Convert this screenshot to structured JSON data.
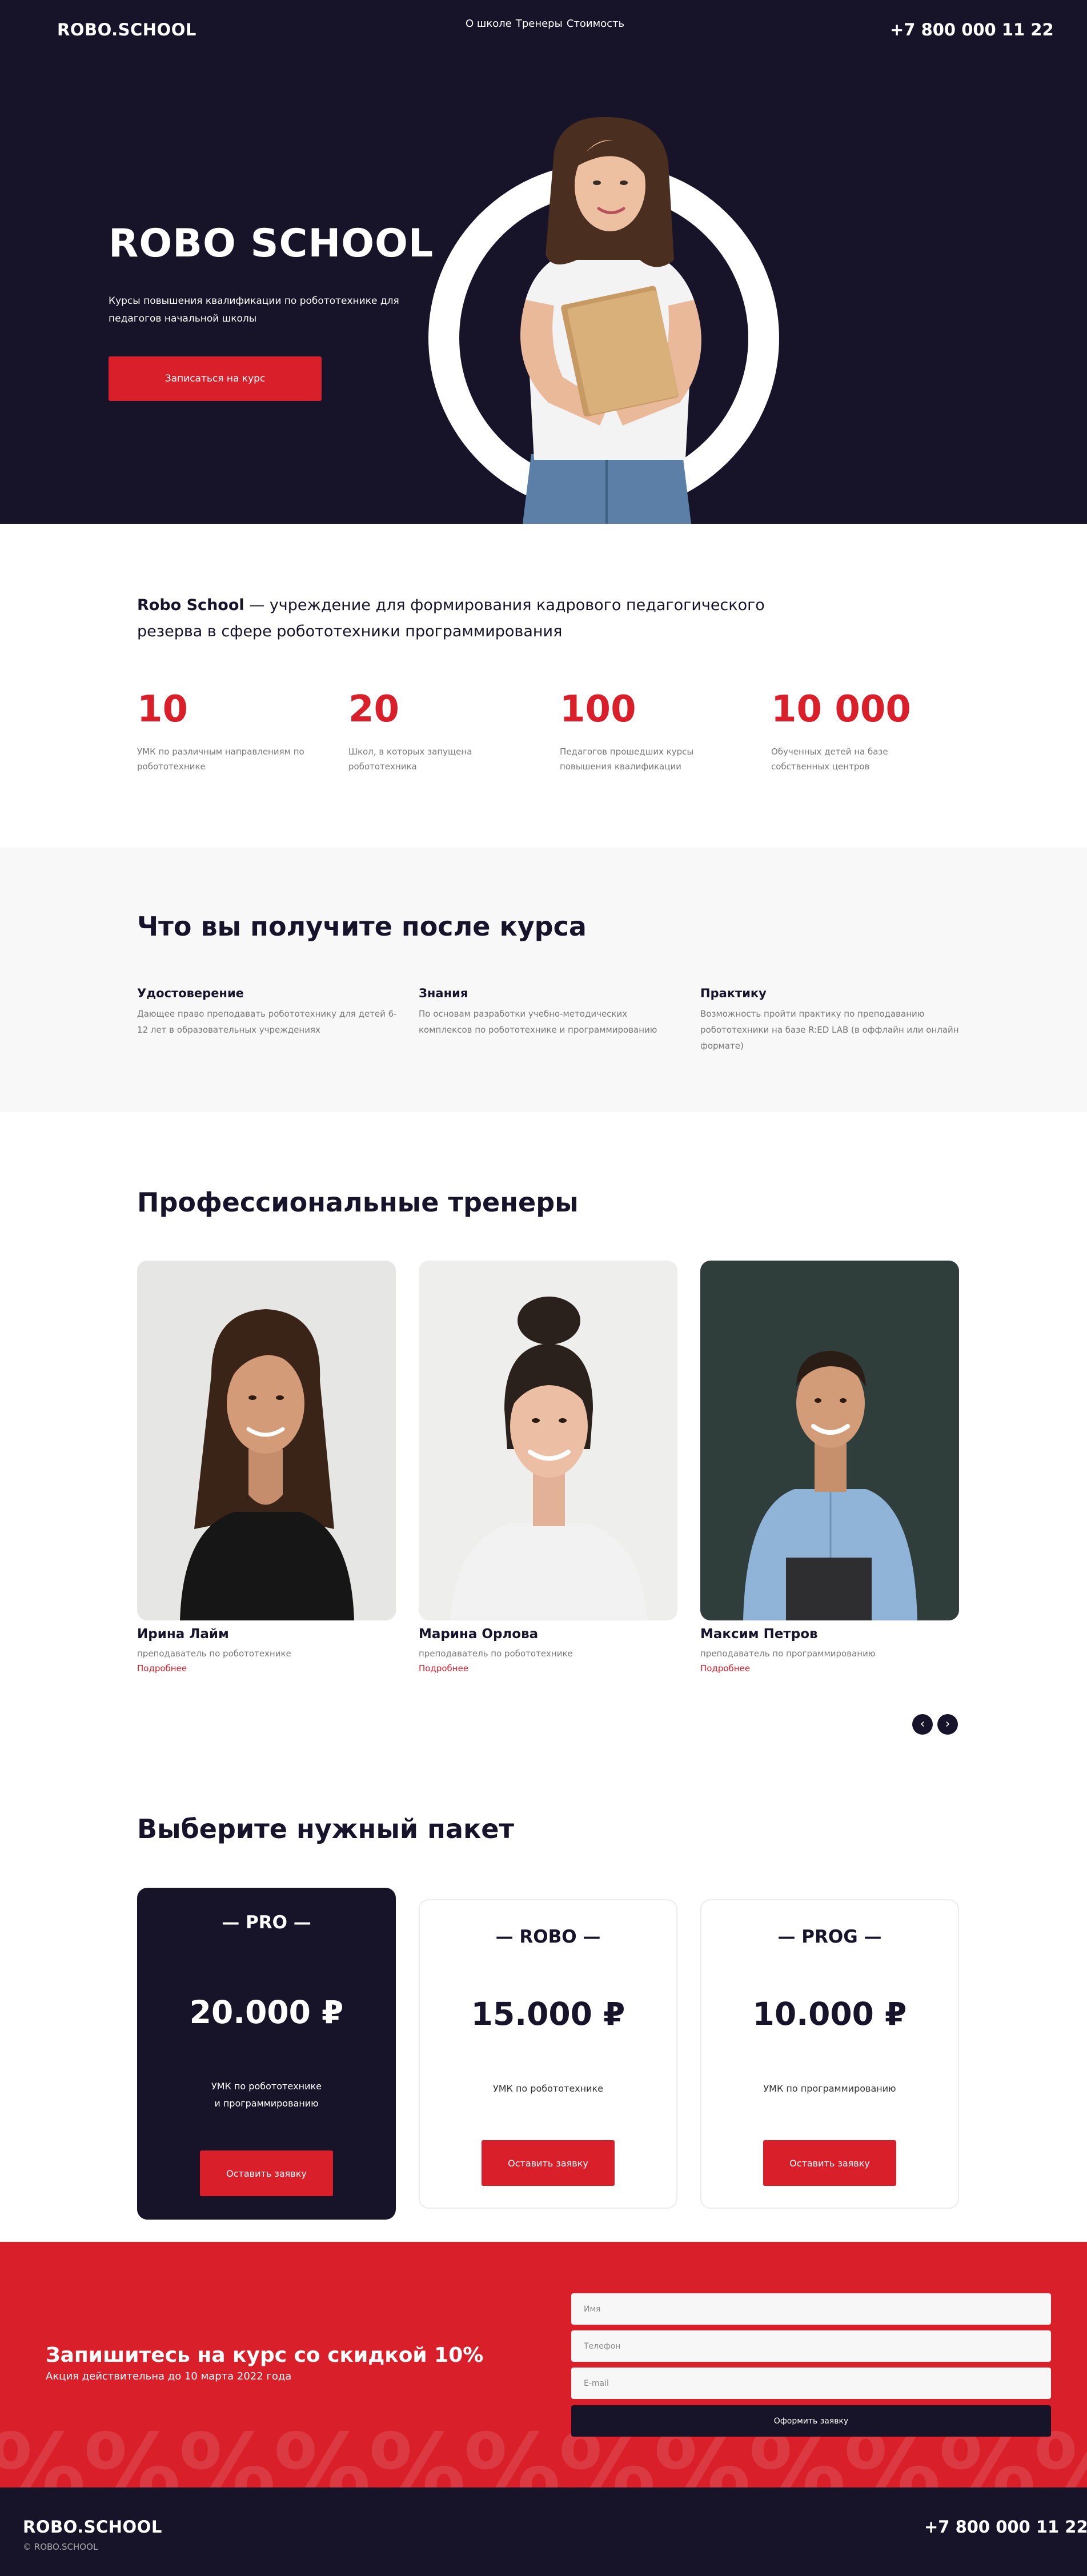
{
  "header": {
    "logo": "ROBO.SCHOOL",
    "nav": [
      "О школе",
      "Тренеры",
      "Стоимость"
    ],
    "phone": "+7 800 000 11 22"
  },
  "hero": {
    "title": "ROBO SCHOOL",
    "subtitle": "Курсы повышения квалификации по робототехнике для педагогов начальной школы",
    "cta": "Записаться на курс"
  },
  "intro": {
    "brand": "Robo School",
    "text": " — учреждение для формирования кадрового педагогического резерва в сфере робототехники программирования"
  },
  "stats": [
    {
      "number": "10",
      "label": "УМК по различным направлениям по робототехнике"
    },
    {
      "number": "20",
      "label": "Школ, в которых запущена робототехника"
    },
    {
      "number": "100",
      "label": "Педагогов прошедших курсы повышения квалификации"
    },
    {
      "number": "10 000",
      "label": "Обученных детей на базе собственных центров"
    }
  ],
  "benefits": {
    "title": "Что вы получите после курса",
    "items": [
      {
        "title": "Удостоверение",
        "text": "Дающее право преподавать робототехнику для детей 6-12 лет в образовательных учреждениях"
      },
      {
        "title": "Знания",
        "text": "По основам разработки учебно-методических комплексов по робототехнике и программированию"
      },
      {
        "title": "Практику",
        "text": "Возможность пройти практику по преподаванию робототехники на базе R:ED LAB (в оффлайн или онлайн формате)"
      }
    ]
  },
  "trainers": {
    "title": "Профессиональные тренеры",
    "more": "Подробнее",
    "items": [
      {
        "name": "Ирина Лайм",
        "role": "преподаватель по робототехнике"
      },
      {
        "name": "Марина Орлова",
        "role": "преподаватель по робототехнике"
      },
      {
        "name": "Максим Петров",
        "role": "преподаватель по программированию"
      }
    ]
  },
  "packages": {
    "title": "Выберите нужный пакет",
    "button": "Оставить заявку",
    "items": [
      {
        "name": "— PRO —",
        "price": "20.000 ₽",
        "desc1": "УМК по робототехнике",
        "desc2": "и программированию"
      },
      {
        "name": "— ROBO —",
        "price": "15.000 ₽",
        "desc1": "УМК по робототехнике",
        "desc2": ""
      },
      {
        "name": "— PROG —",
        "price": "10.000 ₽",
        "desc1": "УМК по программированию",
        "desc2": ""
      }
    ]
  },
  "promo": {
    "title": "Запишитесь на курс со скидкой 10%",
    "subtitle": "Акция действительна до 10 марта 2022 года",
    "name_placeholder": "Имя",
    "phone_placeholder": "Телефон",
    "email_placeholder": "E-mail",
    "submit": "Оформить заявку",
    "pattern": "%%%%%%%%%%%%%%%%%%%%"
  },
  "footer": {
    "logo": "ROBO.SCHOOL",
    "copyright": "© ROBO.SCHOOL",
    "phone": "+7 800 000 11 22"
  },
  "colors": {
    "accent": "#d81f2a",
    "dark": "#17142a",
    "light_gray": "#f8f8f8"
  }
}
